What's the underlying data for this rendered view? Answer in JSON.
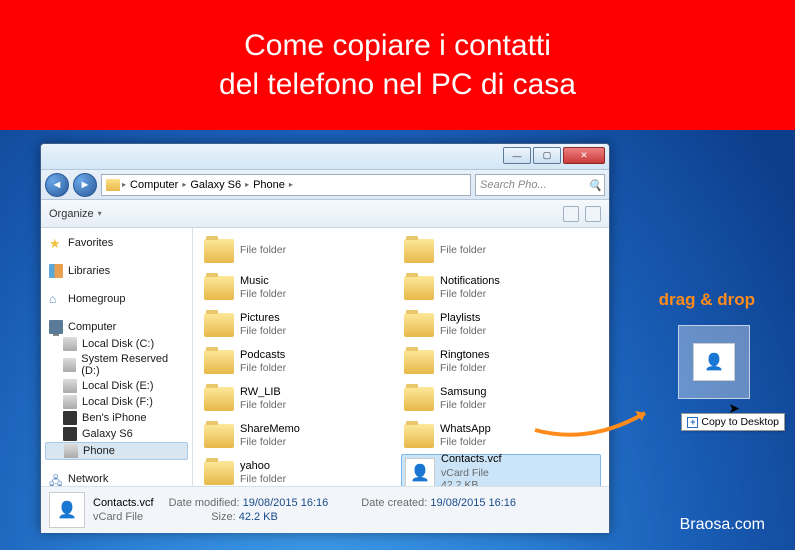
{
  "banner": {
    "line1": "Come copiare i contatti",
    "line2": "del telefono nel PC di casa"
  },
  "window": {
    "breadcrumb": [
      "Computer",
      "Galaxy S6",
      "Phone"
    ],
    "search_placeholder": "Search Pho...",
    "toolbar": {
      "organize": "Organize"
    },
    "sidebar": {
      "favorites": "Favorites",
      "libraries": "Libraries",
      "homegroup": "Homegroup",
      "computer": "Computer",
      "drives": [
        "Local Disk (C:)",
        "System Reserved (D:)",
        "Local Disk (E:)",
        "Local Disk (F:)",
        "Ben's iPhone",
        "Galaxy S6",
        "Phone"
      ],
      "network": "Network"
    },
    "files_col1": [
      {
        "name": "",
        "sub": "File folder"
      },
      {
        "name": "Music",
        "sub": "File folder"
      },
      {
        "name": "Pictures",
        "sub": "File folder"
      },
      {
        "name": "Podcasts",
        "sub": "File folder"
      },
      {
        "name": "RW_LIB",
        "sub": "File folder"
      },
      {
        "name": "ShareMemo",
        "sub": "File folder"
      },
      {
        "name": "yahoo",
        "sub": "File folder"
      }
    ],
    "files_col2": [
      {
        "name": "",
        "sub": "File folder"
      },
      {
        "name": "Notifications",
        "sub": "File folder"
      },
      {
        "name": "Playlists",
        "sub": "File folder"
      },
      {
        "name": "Ringtones",
        "sub": "File folder"
      },
      {
        "name": "Samsung",
        "sub": "File folder"
      },
      {
        "name": "WhatsApp",
        "sub": "File folder"
      },
      {
        "name": "Contacts.vcf",
        "sub": "vCard File",
        "extra": "42.2 KB",
        "vcf": true,
        "sel": true
      }
    ],
    "details": {
      "name": "Contacts.vcf",
      "type": "vCard File",
      "modified_label": "Date modified:",
      "modified": "19/08/2015 16:16",
      "created_label": "Date created:",
      "created": "19/08/2015 16:16",
      "size_label": "Size:",
      "size": "42.2 KB"
    }
  },
  "desktop": {
    "dd_label": "drag & drop",
    "tooltip": "Copy to Desktop",
    "watermark": "Braosa.com"
  }
}
